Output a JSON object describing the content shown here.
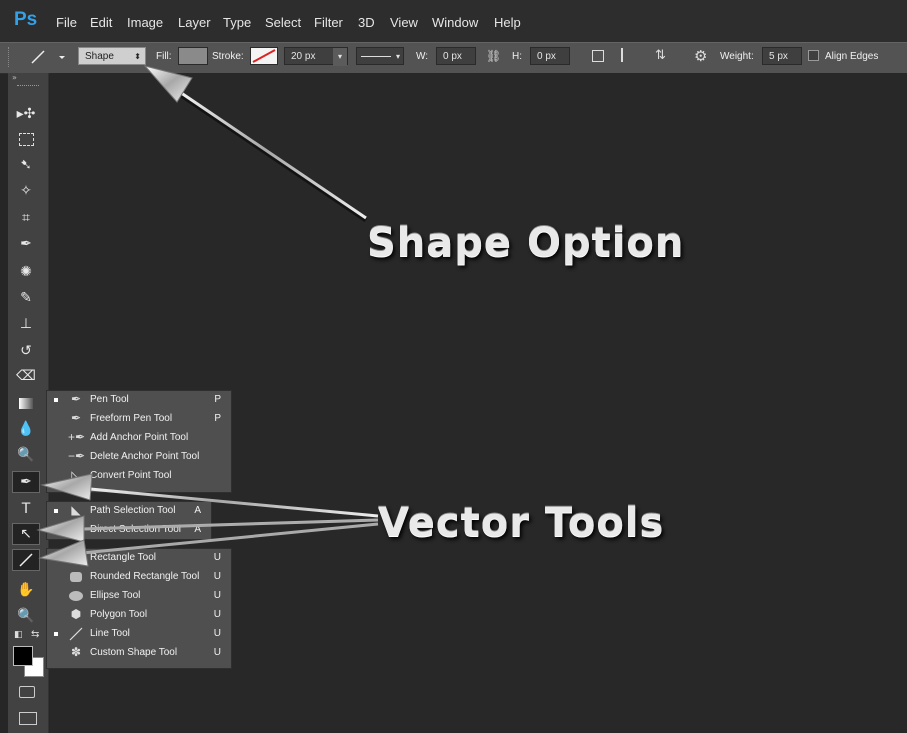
{
  "app": {
    "logo": "Ps"
  },
  "menu": [
    "File",
    "Edit",
    "Image",
    "Layer",
    "Type",
    "Select",
    "Filter",
    "3D",
    "View",
    "Window",
    "Help"
  ],
  "options": {
    "mode": "Shape",
    "fill_label": "Fill:",
    "stroke_label": "Stroke:",
    "stroke_width": "20 px",
    "w_label": "W:",
    "w_value": "0 px",
    "h_label": "H:",
    "h_value": "0 px",
    "weight_label": "Weight:",
    "weight_value": "5 px",
    "align_edges": "Align Edges"
  },
  "pen_flyout": [
    {
      "label": "Pen Tool",
      "key": "P",
      "selected": true
    },
    {
      "label": "Freeform Pen Tool",
      "key": "P",
      "selected": false
    },
    {
      "label": "Add Anchor Point Tool",
      "key": "",
      "selected": false
    },
    {
      "label": "Delete Anchor Point Tool",
      "key": "",
      "selected": false
    },
    {
      "label": "Convert Point Tool",
      "key": "",
      "selected": false
    }
  ],
  "path_flyout": [
    {
      "label": "Path Selection Tool",
      "key": "A",
      "selected": true
    },
    {
      "label": "Direct Selection Tool",
      "key": "A",
      "selected": false
    }
  ],
  "shape_flyout": [
    {
      "label": "Rectangle Tool",
      "key": "U",
      "selected": false
    },
    {
      "label": "Rounded Rectangle Tool",
      "key": "U",
      "selected": false
    },
    {
      "label": "Ellipse Tool",
      "key": "U",
      "selected": false
    },
    {
      "label": "Polygon Tool",
      "key": "U",
      "selected": false
    },
    {
      "label": "Line Tool",
      "key": "U",
      "selected": true
    },
    {
      "label": "Custom Shape Tool",
      "key": "U",
      "selected": false
    }
  ],
  "annotations": {
    "shape_option": "Shape Option",
    "vector_tools": "Vector Tools"
  }
}
